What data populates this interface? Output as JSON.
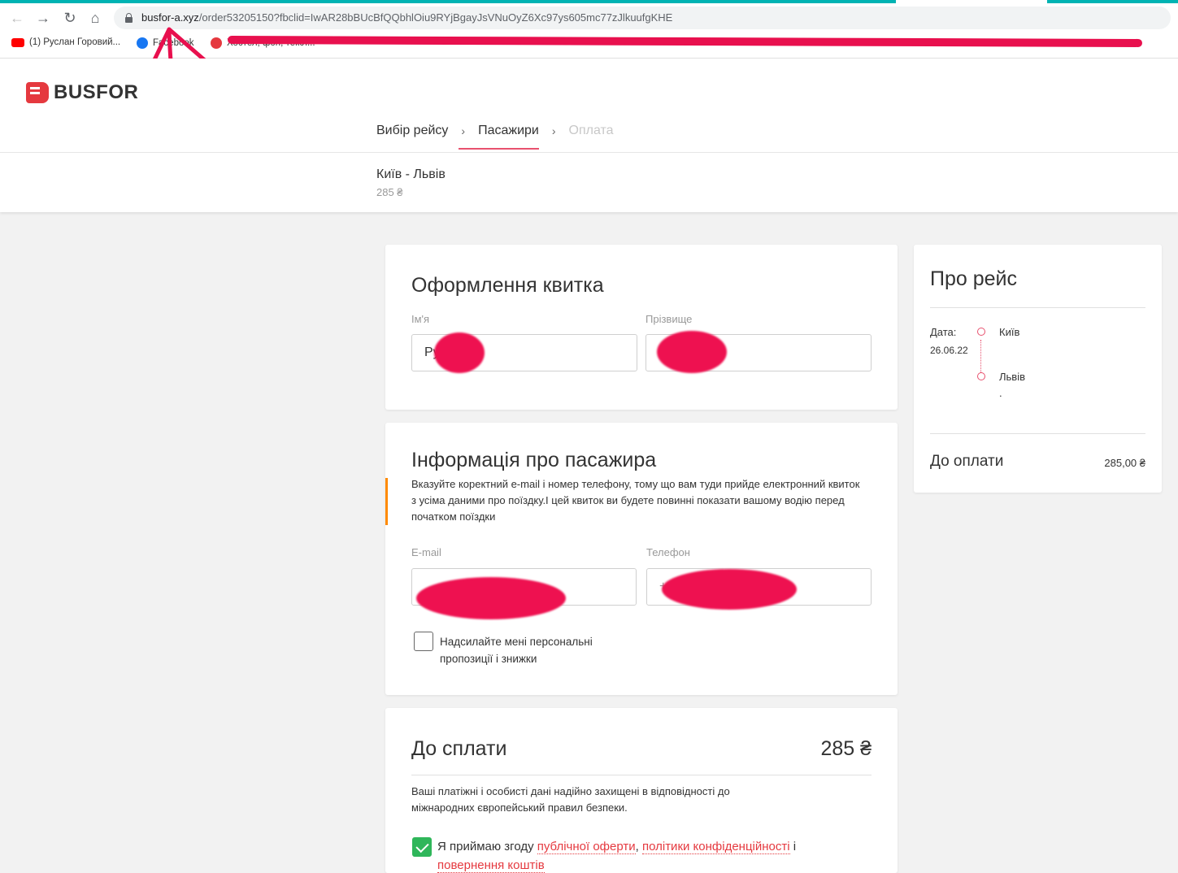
{
  "browser": {
    "url_host": "busfor-a.xyz",
    "url_path": "/order53205150?fbclid=IwAR28bBUcBfQQbhlOiu9RYjBgayJsVNuOyZ6Xc97ys605mc77zJlkuufgKHE",
    "bookmarks": [
      "(1) Руслан Горовий...",
      "Facebook",
      "Хостел, фон, текст..."
    ],
    "bookmark_colors": {
      "youtube": "#ff0000",
      "facebook": "#1877f2",
      "red": "#e5393f"
    }
  },
  "header": {
    "logo": "BUSFOR",
    "steps": [
      "Вибір рейсу",
      "Пасажири",
      "Оплата"
    ],
    "step_sep": "›"
  },
  "route": {
    "title": "Київ - Львів",
    "price": "285 ₴"
  },
  "ticket_form": {
    "title": "Оформлення квитка",
    "first_name_label": "Ім'я",
    "first_name_value": "Ру",
    "last_name_label": "Прізвище"
  },
  "passenger": {
    "title": "Інформація про пасажира",
    "note": "Вказуйте коректний e-mail і номер телефону, тому що вам туди прийде електронний квиток з усіма даними про поїздку.І цей квиток ви будете повинні показати вашому водію перед початком поїздки",
    "email_label": "E-mail",
    "phone_label": "Телефон",
    "phone_prefix": "+",
    "promo_label": "Надсилайте мені персональні пропозиції і знижки"
  },
  "payment": {
    "title": "До сплати",
    "amount": "285 ₴",
    "security_note": "Ваші платіжні і особисті дані надійно захищені в відповідності до міжнародних європейський правил безпеки.",
    "consent_prefix": "Я приймаю згоду",
    "link_offer": "публічної оферти",
    "comma": ",",
    "link_privacy": "політики конфіденційності",
    "and": "і",
    "link_refund": "повернення коштів"
  },
  "trip": {
    "title": "Про рейс",
    "date_label": "Дата:",
    "date_value": "26.06.22",
    "from": "Київ",
    "to": "Львів",
    "to_sub": ".",
    "total_label": "До оплати",
    "total_value": "285,00 ₴"
  }
}
